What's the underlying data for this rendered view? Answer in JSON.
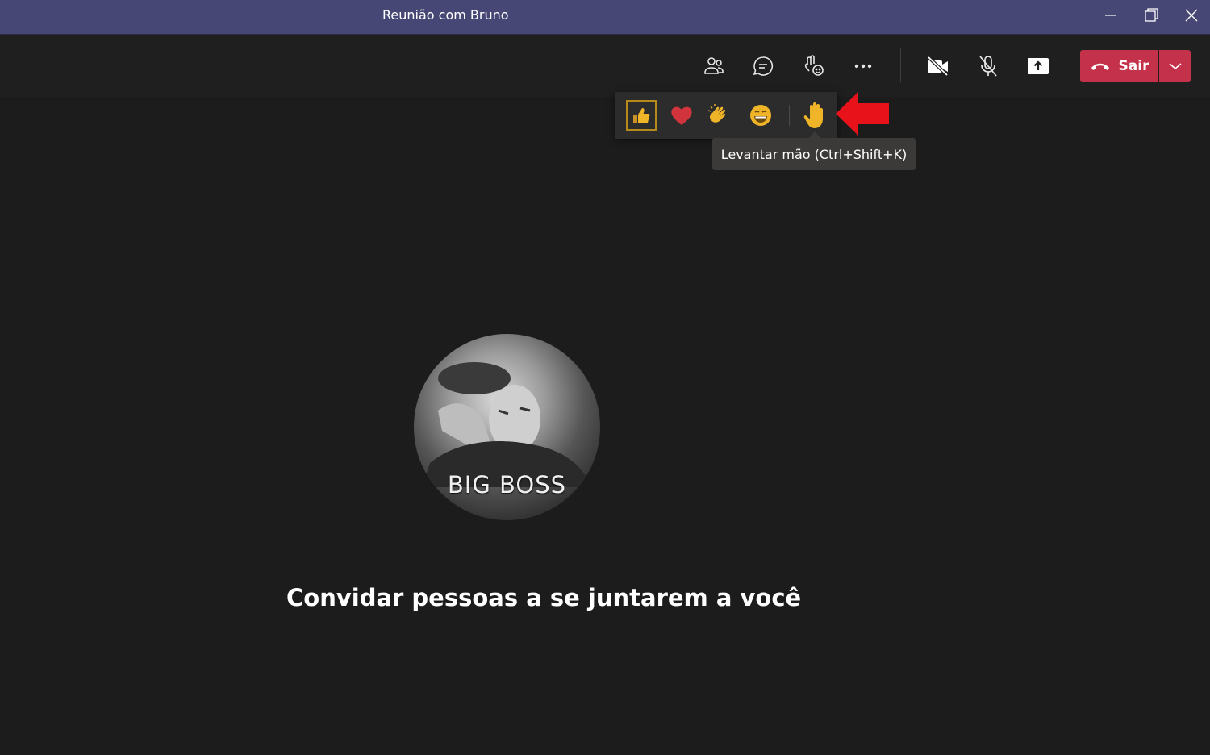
{
  "window": {
    "title": "Reunião com Bruno"
  },
  "toolbar": {
    "buttons": [
      "participants-icon",
      "chat-icon",
      "reactions-icon",
      "more-options-icon",
      "camera-off-icon",
      "mic-off-icon",
      "share-screen-icon"
    ],
    "leave_label": "Sair"
  },
  "reactions": {
    "items": [
      "thumbs-up",
      "heart",
      "clapping-hands",
      "laughing-face",
      "raised-hand"
    ],
    "selected": "thumbs-up",
    "tooltip": "Levantar mão (Ctrl+Shift+K)"
  },
  "avatar": {
    "caption": "BIG BOSS"
  },
  "main": {
    "invite_text": "Convidar pessoas a se juntarem a você"
  },
  "colors": {
    "titlebar": "#464775",
    "background": "#1f1f1f",
    "leave_button": "#c4314b",
    "annotation_arrow": "#e8121b"
  }
}
